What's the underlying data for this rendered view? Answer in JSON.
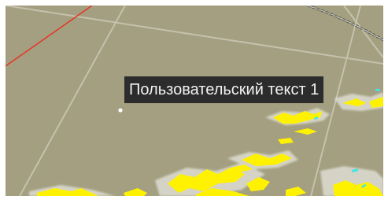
{
  "map": {
    "label_text": "Пользовательский текст 1",
    "colors": {
      "background": "#a39f80",
      "grid_line": "#cbc8b5",
      "red_line": "#e33a2a",
      "route_line": "#4d4d4d",
      "precipitation_yellow": "#fff200",
      "precipitation_cyan": "#3fe6e8",
      "label_background": "#2c2c2c",
      "label_text": "#f2f2f2",
      "marker": "#ffffff"
    }
  }
}
